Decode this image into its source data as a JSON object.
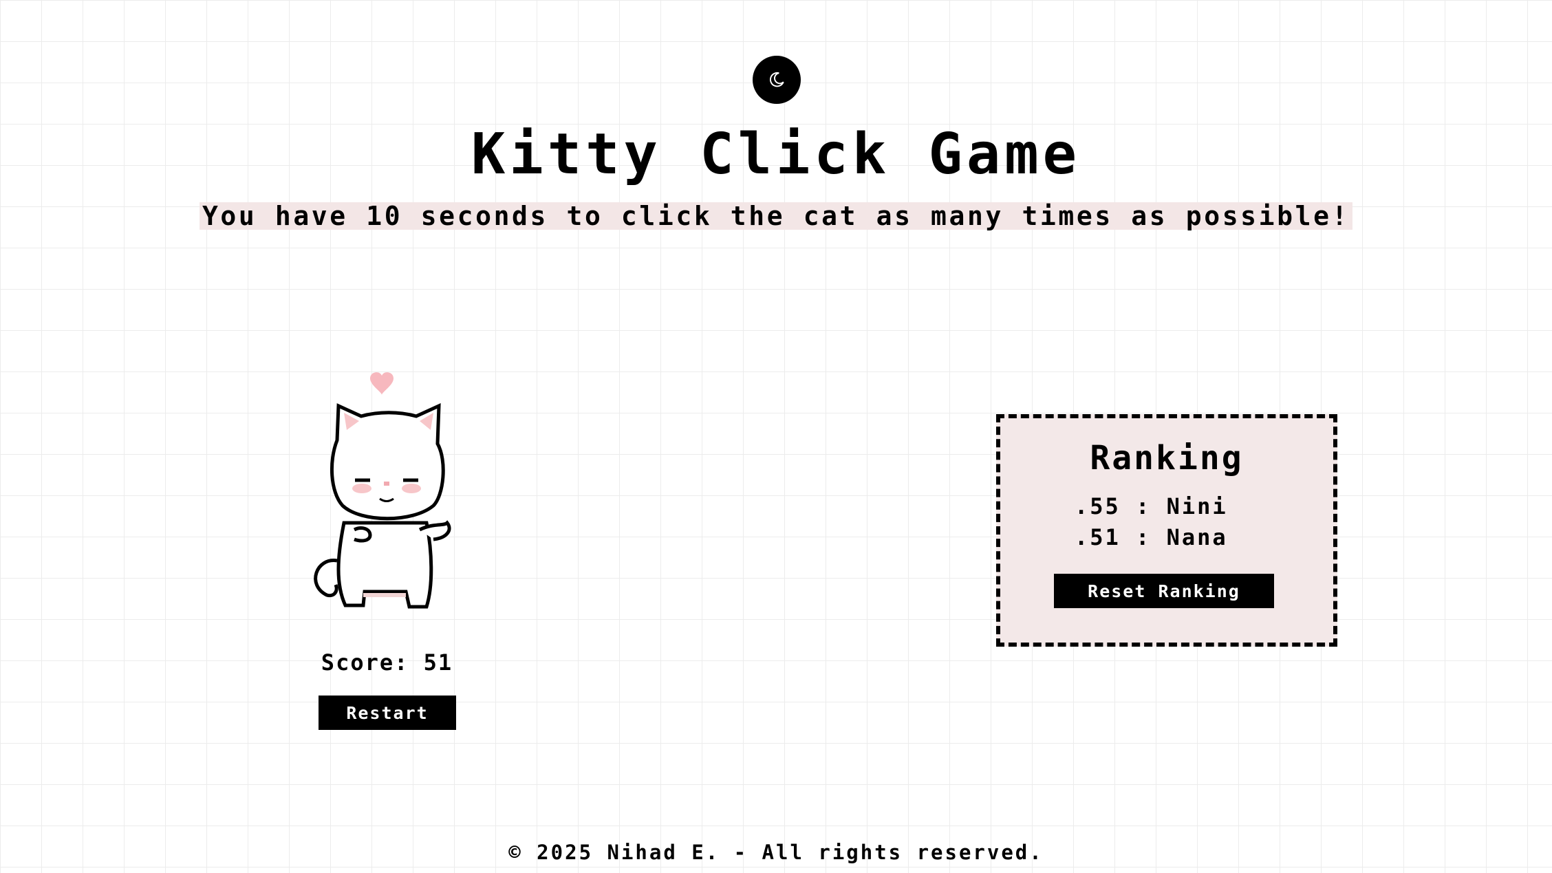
{
  "theme_toggle": {
    "icon": "moon-icon"
  },
  "header": {
    "title": "Kitty Click Game",
    "subtitle": "You have 10 seconds to click the cat as many times as possible!"
  },
  "game": {
    "cat_image": "cat-icon",
    "heart_icon": "heart-icon",
    "score_label": "Score: 51",
    "restart_label": "Restart"
  },
  "ranking": {
    "title": "Ranking",
    "entries": [
      {
        "text": ".55 : Nini"
      },
      {
        "text": ".51 : Nana"
      }
    ],
    "reset_label": "Reset Ranking"
  },
  "footer": {
    "text": "© 2025 Nihad E. - All rights reserved."
  },
  "colors": {
    "accent_bg": "#f3e6e6",
    "heart": "#f7b8be",
    "button": "#000000"
  }
}
